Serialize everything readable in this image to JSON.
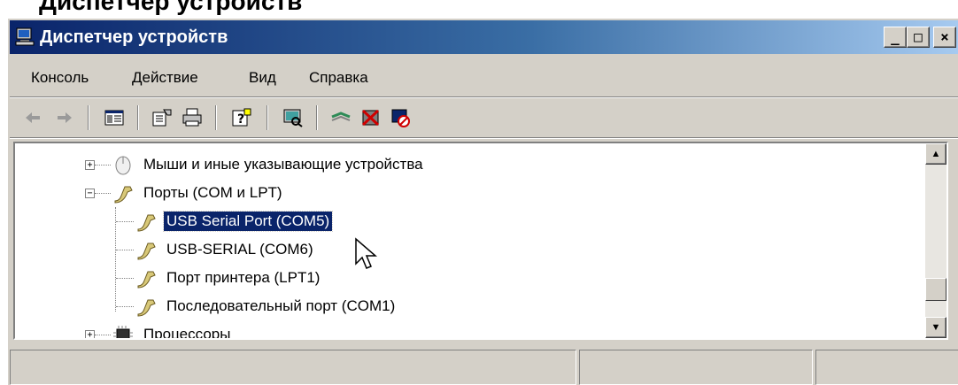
{
  "page_caption": "Диспетчер устройств",
  "window": {
    "title": "Диспетчер устройств",
    "controls": {
      "minimize": "_",
      "maximize": "□",
      "close": "×"
    }
  },
  "menu": [
    "Консоль",
    "Действие",
    "Вид",
    "Справка"
  ],
  "toolbar": {
    "icons": [
      "back-arrow-icon",
      "forward-arrow-icon",
      "show-hide-tree-icon",
      "properties-icon",
      "print-icon",
      "help-icon",
      "scan-hardware-icon",
      "update-driver-icon",
      "uninstall-icon",
      "disable-icon"
    ]
  },
  "tree": {
    "items": [
      {
        "label": "Мыши и иные указывающие устройства",
        "expander": "+"
      },
      {
        "label": "Порты (COM и LPT)",
        "expander": "−"
      },
      {
        "label": "USB Serial Port (COM5)",
        "selected": true
      },
      {
        "label": "USB-SERIAL (COM6)"
      },
      {
        "label": "Порт принтера (LPT1)"
      },
      {
        "label": "Последовательный порт (COM1)"
      },
      {
        "label": "Процессоры",
        "expander": "+"
      }
    ]
  },
  "colors": {
    "titlebar_start": "#0a246a",
    "titlebar_end": "#a6caf0",
    "selection": "#0a246a",
    "face": "#d4d0c8"
  }
}
